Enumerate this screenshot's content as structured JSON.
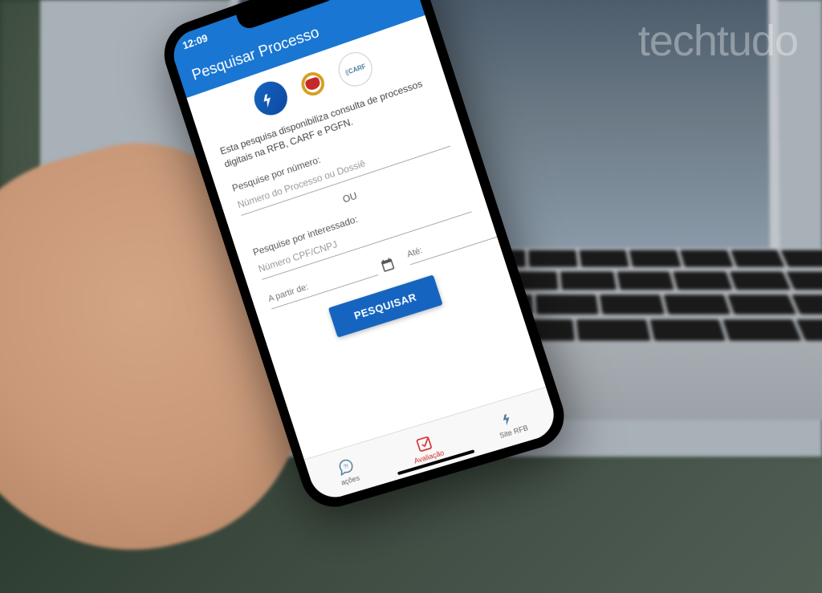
{
  "watermark": "techtudo",
  "status": {
    "time": "12:09"
  },
  "header": {
    "title": "Pesquisar Processo"
  },
  "logos": {
    "carf_text": "CARF"
  },
  "description": "Esta pesquisa disponibiliza consulta de processos digitais na RFB, CARF e PGFN.",
  "section_number": {
    "label": "Pesquise por número:",
    "placeholder": "Número do Processo ou Dossiê"
  },
  "separator": "OU",
  "section_interested": {
    "label": "Pesquise por interessado:",
    "placeholder": "Número CPF/CNPJ"
  },
  "date_from": {
    "label": "A partir de:"
  },
  "date_to": {
    "label": "Até:"
  },
  "search_button": "PESQUISAR",
  "nav": {
    "acoes": "ações",
    "avaliacao": "Avaliação",
    "site": "Site RFB"
  }
}
